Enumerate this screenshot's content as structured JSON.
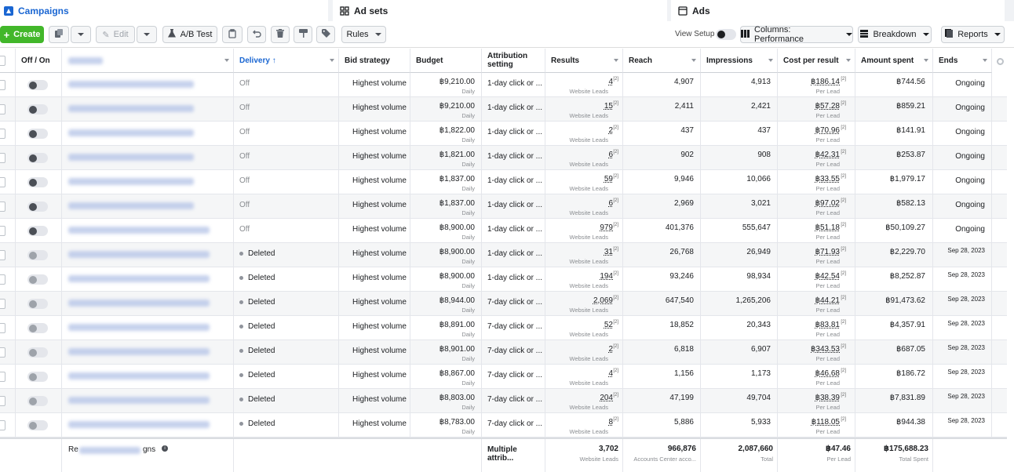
{
  "tabs": {
    "campaigns": "Campaigns",
    "adsets": "Ad sets",
    "ads": "Ads"
  },
  "toolbar": {
    "create": "Create",
    "edit": "Edit",
    "ab_test": "A/B Test",
    "rules": "Rules",
    "view_setup": "View Setup",
    "columns": "Columns: Performance",
    "breakdown": "Breakdown",
    "reports": "Reports"
  },
  "columns": {
    "off_on": "Off / On",
    "delivery": "Delivery ↑",
    "bid_strategy": "Bid strategy",
    "budget": "Budget",
    "attribution": "Attribution setting",
    "results": "Results",
    "reach": "Reach",
    "impressions": "Impressions",
    "cost_per_result": "Cost per result",
    "amount_spent": "Amount spent",
    "ends": "Ends"
  },
  "rows": [
    {
      "on": true,
      "delivery": "Off",
      "deleted": false,
      "bid": "Highest volume",
      "budget": "฿9,210.00",
      "budget_sub": "Daily",
      "attr": "1-day click or ...",
      "results": "4",
      "results_sub": "Website Leads",
      "reach": "4,907",
      "impr": "4,913",
      "cpr": "฿186.14",
      "cpr_sub": "Per Lead",
      "spent": "฿744.56",
      "ends": "Ongoing"
    },
    {
      "on": true,
      "delivery": "Off",
      "deleted": false,
      "bid": "Highest volume",
      "budget": "฿9,210.00",
      "budget_sub": "Daily",
      "attr": "1-day click or ...",
      "results": "15",
      "results_sub": "Website Leads",
      "reach": "2,411",
      "impr": "2,421",
      "cpr": "฿57.28",
      "cpr_sub": "Per Lead",
      "spent": "฿859.21",
      "ends": "Ongoing"
    },
    {
      "on": true,
      "delivery": "Off",
      "deleted": false,
      "bid": "Highest volume",
      "budget": "฿1,822.00",
      "budget_sub": "Daily",
      "attr": "1-day click or ...",
      "results": "2",
      "results_sub": "Website Leads",
      "reach": "437",
      "impr": "437",
      "cpr": "฿70.96",
      "cpr_sub": "Per Lead",
      "spent": "฿141.91",
      "ends": "Ongoing"
    },
    {
      "on": true,
      "delivery": "Off",
      "deleted": false,
      "bid": "Highest volume",
      "budget": "฿1,821.00",
      "budget_sub": "Daily",
      "attr": "1-day click or ...",
      "results": "6",
      "results_sub": "Website Leads",
      "reach": "902",
      "impr": "908",
      "cpr": "฿42.31",
      "cpr_sub": "Per Lead",
      "spent": "฿253.87",
      "ends": "Ongoing"
    },
    {
      "on": true,
      "delivery": "Off",
      "deleted": false,
      "bid": "Highest volume",
      "budget": "฿1,837.00",
      "budget_sub": "Daily",
      "attr": "1-day click or ...",
      "results": "59",
      "results_sub": "Website Leads",
      "reach": "9,946",
      "impr": "10,066",
      "cpr": "฿33.55",
      "cpr_sub": "Per Lead",
      "spent": "฿1,979.17",
      "ends": "Ongoing"
    },
    {
      "on": true,
      "delivery": "Off",
      "deleted": false,
      "bid": "Highest volume",
      "budget": "฿1,837.00",
      "budget_sub": "Daily",
      "attr": "1-day click or ...",
      "results": "6",
      "results_sub": "Website Leads",
      "reach": "2,969",
      "impr": "3,021",
      "cpr": "฿97.02",
      "cpr_sub": "Per Lead",
      "spent": "฿582.13",
      "ends": "Ongoing"
    },
    {
      "on": true,
      "delivery": "Off",
      "deleted": false,
      "bid": "Highest volume",
      "budget": "฿8,900.00",
      "budget_sub": "Daily",
      "attr": "1-day click or ...",
      "results": "979",
      "results_sub": "Website Leads",
      "reach": "401,376",
      "impr": "555,647",
      "cpr": "฿51.18",
      "cpr_sub": "Per Lead",
      "spent": "฿50,109.27",
      "ends": "Ongoing"
    },
    {
      "on": false,
      "delivery": "Deleted",
      "deleted": true,
      "bid": "Highest volume",
      "budget": "฿8,900.00",
      "budget_sub": "Daily",
      "attr": "1-day click or ...",
      "results": "31",
      "results_sub": "Website Leads",
      "reach": "26,768",
      "impr": "26,949",
      "cpr": "฿71.93",
      "cpr_sub": "Per Lead",
      "spent": "฿2,229.70",
      "ends": "Sep 28, 2023"
    },
    {
      "on": false,
      "delivery": "Deleted",
      "deleted": true,
      "bid": "Highest volume",
      "budget": "฿8,900.00",
      "budget_sub": "Daily",
      "attr": "1-day click or ...",
      "results": "194",
      "results_sub": "Website Leads",
      "reach": "93,246",
      "impr": "98,934",
      "cpr": "฿42.54",
      "cpr_sub": "Per Lead",
      "spent": "฿8,252.87",
      "ends": "Sep 28, 2023"
    },
    {
      "on": false,
      "delivery": "Deleted",
      "deleted": true,
      "bid": "Highest volume",
      "budget": "฿8,944.00",
      "budget_sub": "Daily",
      "attr": "7-day click or ...",
      "results": "2,069",
      "results_sub": "Website Leads",
      "reach": "647,540",
      "impr": "1,265,206",
      "cpr": "฿44.21",
      "cpr_sub": "Per Lead",
      "spent": "฿91,473.62",
      "ends": "Sep 28, 2023"
    },
    {
      "on": false,
      "delivery": "Deleted",
      "deleted": true,
      "bid": "Highest volume",
      "budget": "฿8,891.00",
      "budget_sub": "Daily",
      "attr": "7-day click or ...",
      "results": "52",
      "results_sub": "Website Leads",
      "reach": "18,852",
      "impr": "20,343",
      "cpr": "฿83.81",
      "cpr_sub": "Per Lead",
      "spent": "฿4,357.91",
      "ends": "Sep 28, 2023"
    },
    {
      "on": false,
      "delivery": "Deleted",
      "deleted": true,
      "bid": "Highest volume",
      "budget": "฿8,901.00",
      "budget_sub": "Daily",
      "attr": "7-day click or ...",
      "results": "2",
      "results_sub": "Website Leads",
      "reach": "6,818",
      "impr": "6,907",
      "cpr": "฿343.53",
      "cpr_sub": "Per Lead",
      "spent": "฿687.05",
      "ends": "Sep 28, 2023"
    },
    {
      "on": false,
      "delivery": "Deleted",
      "deleted": true,
      "bid": "Highest volume",
      "budget": "฿8,867.00",
      "budget_sub": "Daily",
      "attr": "7-day click or ...",
      "results": "4",
      "results_sub": "Website Leads",
      "reach": "1,156",
      "impr": "1,173",
      "cpr": "฿46.68",
      "cpr_sub": "Per Lead",
      "spent": "฿186.72",
      "ends": "Sep 28, 2023"
    },
    {
      "on": false,
      "delivery": "Deleted",
      "deleted": true,
      "bid": "Highest volume",
      "budget": "฿8,803.00",
      "budget_sub": "Daily",
      "attr": "7-day click or ...",
      "results": "204",
      "results_sub": "Website Leads",
      "reach": "47,199",
      "impr": "49,704",
      "cpr": "฿38.39",
      "cpr_sub": "Per Lead",
      "spent": "฿7,831.89",
      "ends": "Sep 28, 2023"
    },
    {
      "on": false,
      "delivery": "Deleted",
      "deleted": true,
      "bid": "Highest volume",
      "budget": "฿8,783.00",
      "budget_sub": "Daily",
      "attr": "7-day click or ...",
      "results": "8",
      "results_sub": "Website Leads",
      "reach": "5,886",
      "impr": "5,933",
      "cpr": "฿118.05",
      "cpr_sub": "Per Lead",
      "spent": "฿944.38",
      "ends": "Sep 28, 2023"
    }
  ],
  "footer": {
    "label": "Re",
    "label_end": "gns",
    "attr": "Multiple attrib...",
    "results": "3,702",
    "results_sub": "Website Leads",
    "reach": "966,876",
    "reach_sub": "Accounts Center acco...",
    "impr": "2,087,660",
    "impr_sub": "Total",
    "cpr": "฿47.46",
    "cpr_sub": "Per Lead",
    "spent": "฿175,688.23",
    "spent_sub": "Total Spent"
  },
  "colors": {
    "accent": "#1a66d2",
    "create": "#42b72a"
  }
}
